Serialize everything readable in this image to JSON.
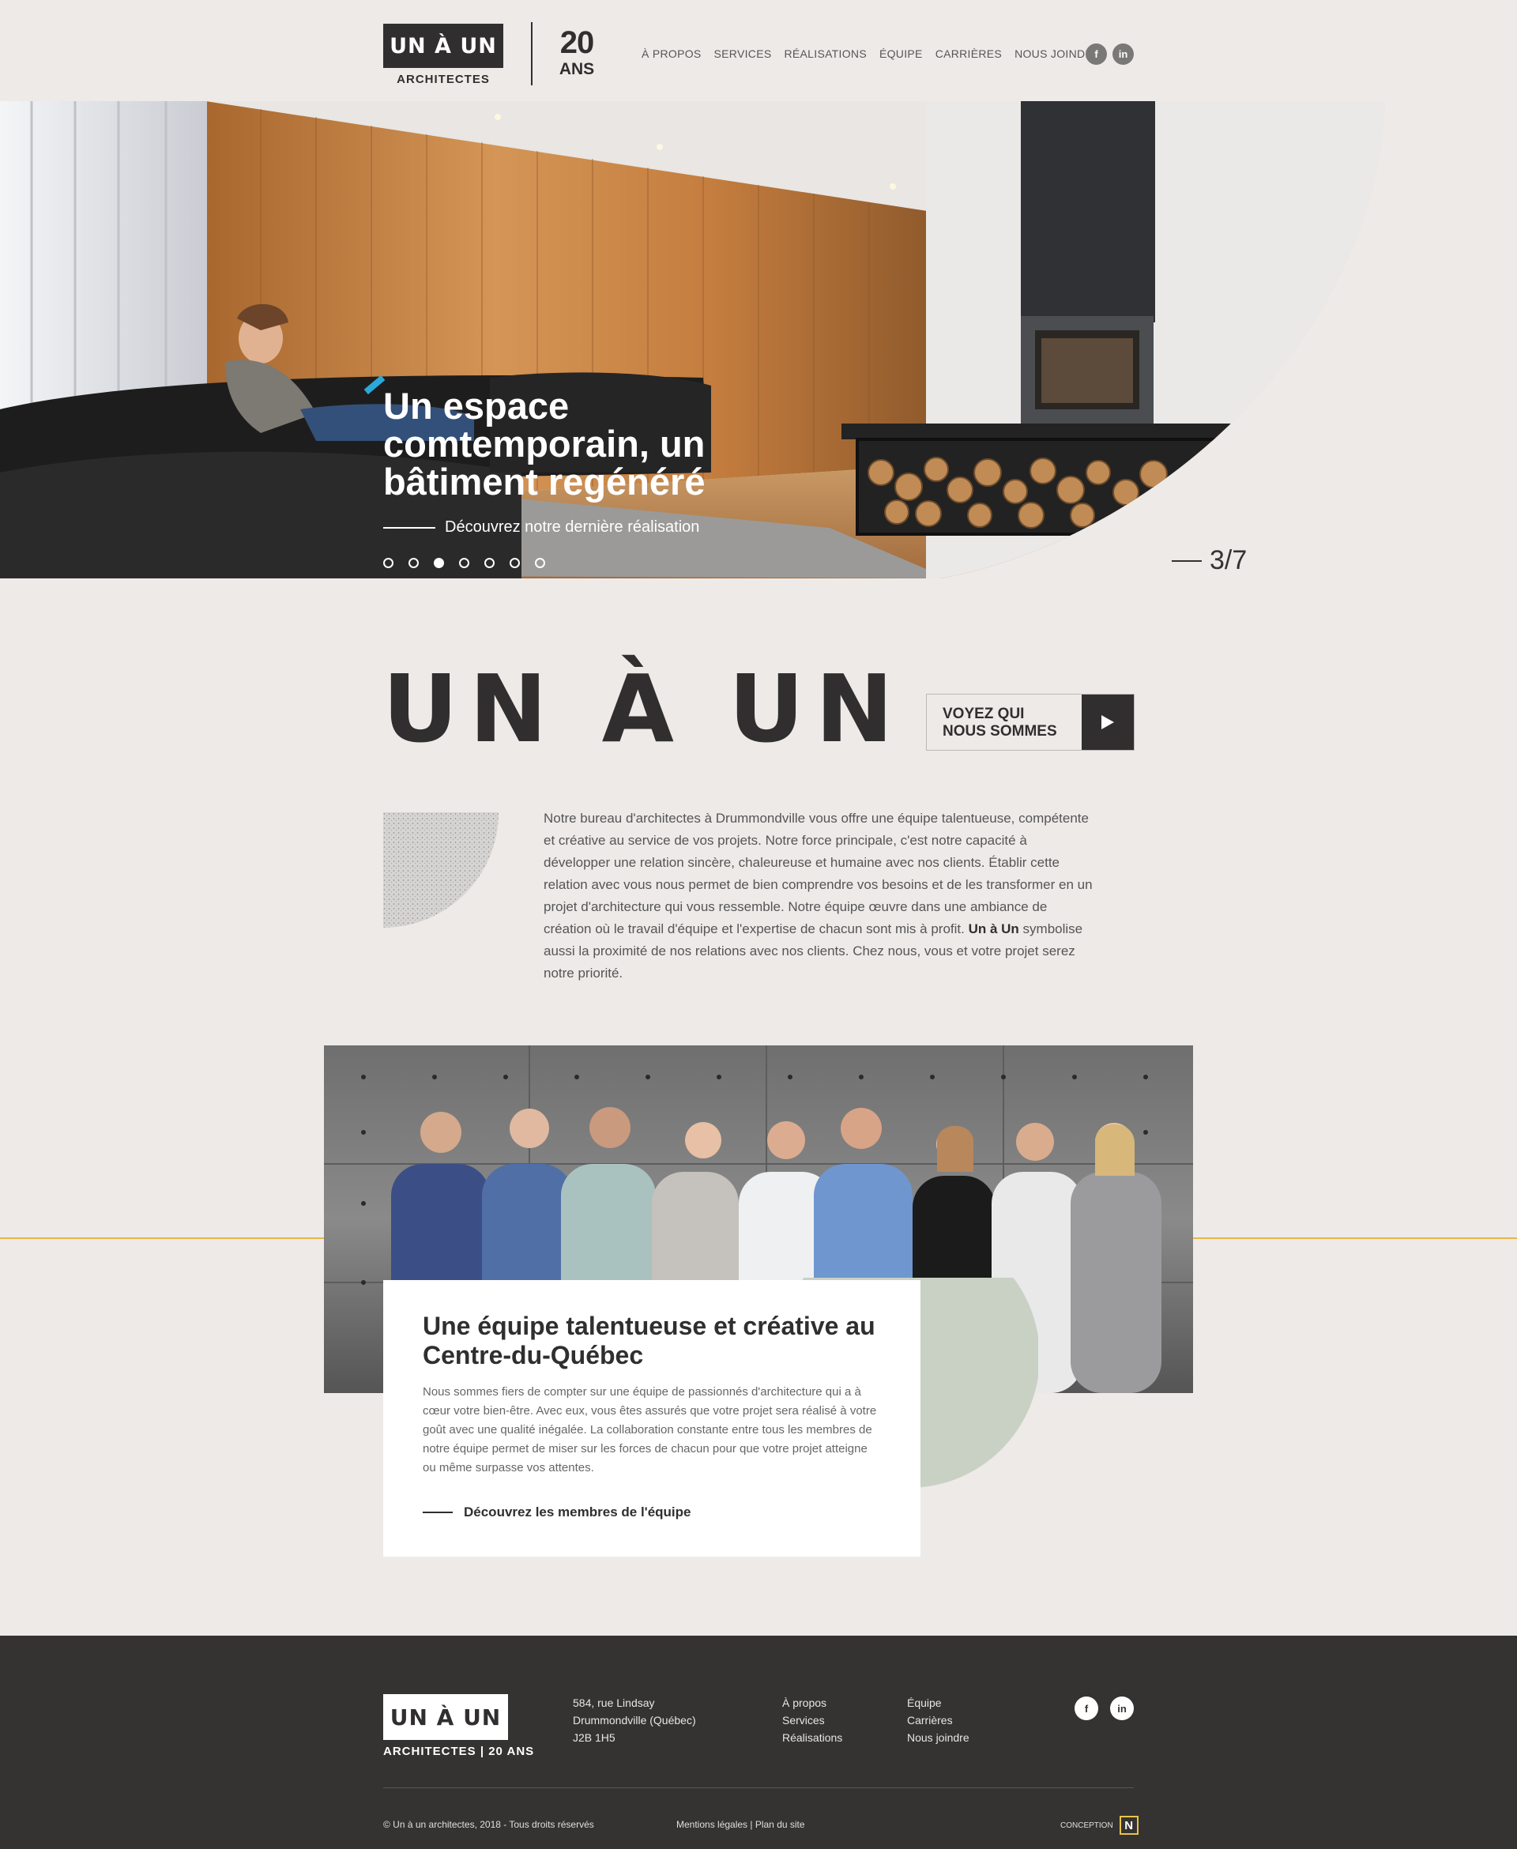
{
  "header": {
    "logo_text": "UN À UN",
    "logo_sub": "ARCHITECTES",
    "anniversary_number": "20",
    "anniversary_label": "ANS",
    "nav": [
      "À PROPOS",
      "SERVICES",
      "RÉALISATIONS",
      "ÉQUIPE",
      "CARRIÈRES",
      "NOUS JOINDRE"
    ],
    "social": {
      "facebook": "f",
      "linkedin": "in"
    }
  },
  "hero": {
    "title": "Un espace comtemporain, un bâtiment regénéré",
    "link": "Découvrez notre dernière réalisation",
    "slide_count": 7,
    "active_slide": 3,
    "counter": "3/7"
  },
  "about": {
    "title": "UN À UN",
    "cta": "VOYEZ QUI NOUS SOMMES",
    "paragraph": "Notre bureau d'architectes à Drummondville vous offre une équipe talentueuse, compétente et créative au service de vos projets. Notre force principale, c'est notre capacité à développer une relation sincère, chaleureuse et humaine avec nos clients. Établir cette relation avec vous nous permet de bien comprendre vos besoins et de les transformer en un projet d'architecture qui vous ressemble. Notre équipe œuvre dans une ambiance de création où le travail d'équipe et l'expertise de chacun sont mis à profit.",
    "brand_bold": "Un à Un",
    "paragraph_end": " symbolise aussi la proximité de nos relations avec nos clients. Chez nous, vous et votre projet serez notre priorité."
  },
  "team": {
    "title": "Une équipe talentueuse et créative au Centre-du-Québec",
    "text": "Nous sommes fiers de compter sur une équipe de passionnés d'architecture qui a à cœur votre bien-être. Avec eux, vous êtes assurés que votre projet sera réalisé à votre goût avec une qualité inégalée. La collaboration constante entre tous les membres de notre équipe permet de miser sur les forces de chacun pour que votre projet atteigne ou même surpasse vos attentes.",
    "link": "Découvrez les membres de l'équipe"
  },
  "footer": {
    "logo_text": "UN À UN",
    "logo_sub": "ARCHITECTES | 20 ANS",
    "address": [
      "584, rue Lindsay",
      "Drummondville (Québec)",
      "J2B 1H5"
    ],
    "links_col1": [
      "À propos",
      "Services",
      "Réalisations"
    ],
    "links_col2": [
      "Équipe",
      "Carrières",
      "Nous joindre"
    ],
    "copyright": "© Un à un architectes, 2018 - Tous droits réservés",
    "legal": "Mentions légales | Plan du site",
    "conception": "CONCEPTION",
    "conception_logo": "N"
  },
  "colors": {
    "dark": "#302e2e",
    "background": "#eeeae8",
    "gold": "#e8b54a",
    "sage": "#c9d1c4",
    "footer": "#353332"
  }
}
